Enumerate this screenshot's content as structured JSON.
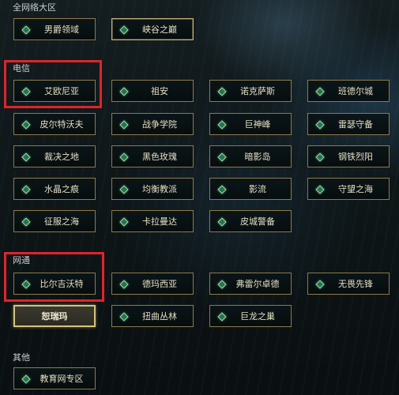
{
  "sections": {
    "all_network": "全网络大区",
    "telecom": "电信",
    "netcom": "网通",
    "other": "其他"
  },
  "top_servers": [
    "男爵领域",
    "峡谷之巅"
  ],
  "telecom_servers": [
    "艾欧尼亚",
    "祖安",
    "诺克萨斯",
    "班德尔城",
    "皮尔特沃夫",
    "战争学院",
    "巨神峰",
    "雷瑟守备",
    "裁决之地",
    "黑色玫瑰",
    "暗影岛",
    "钢铁烈阳",
    "水晶之痕",
    "均衡教派",
    "影流",
    "守望之海",
    "征服之海",
    "卡拉曼达",
    "皮城警备"
  ],
  "netcom_servers": [
    "比尔吉沃特",
    "德玛西亚",
    "弗雷尔卓德",
    "无畏先锋",
    "恕瑞玛",
    "扭曲丛林",
    "巨龙之巢"
  ],
  "other_servers": [
    "教育网专区"
  ],
  "colors": {
    "highlight_box": "#e0242a",
    "button_border": "#8d7a4a",
    "active_border": "#d8c27a",
    "diamond": "#147a5c"
  }
}
